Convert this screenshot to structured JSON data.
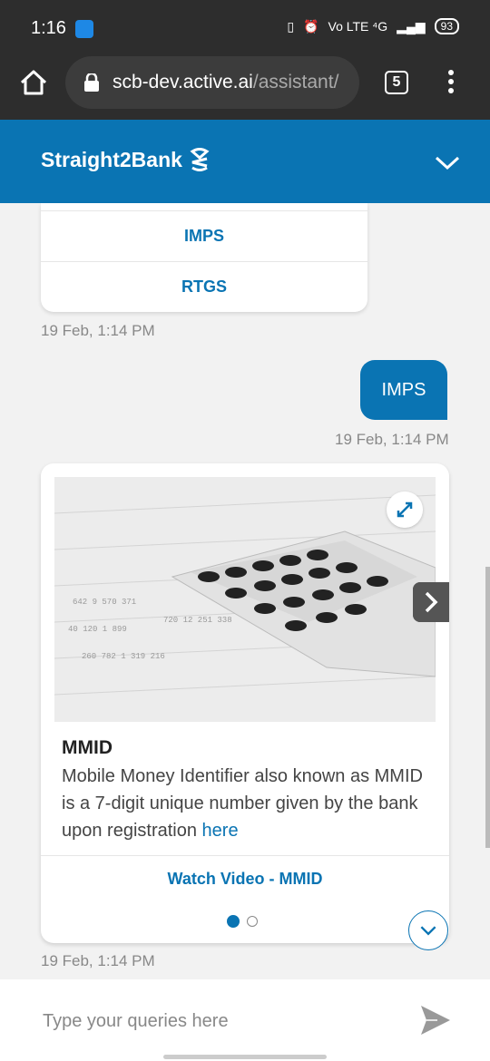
{
  "status_bar": {
    "time": "1:16",
    "network": "Vo LTE ⁴G",
    "battery": "93"
  },
  "browser": {
    "url_host": "scb-dev.active.ai",
    "url_path": "/assistant/",
    "tab_count": "5"
  },
  "header": {
    "brand": "Straight2Bank",
    "accent_color": "#0a74b3"
  },
  "chat": {
    "options": [
      {
        "label": "IMPS"
      },
      {
        "label": "RTGS"
      }
    ],
    "options_time": "19 Feb, 1:14 PM",
    "user_message": {
      "text": "IMPS",
      "time": "19 Feb, 1:14 PM"
    },
    "carousel": {
      "title": "MMID",
      "description": "Mobile Money Identifier also known as MMID is a 7-digit unique number given by the bank upon registration ",
      "link_text": "here",
      "action_label": "Watch Video - MMID",
      "time": "19 Feb, 1:14 PM",
      "page_count": 2,
      "active_page": 1
    }
  },
  "composer": {
    "placeholder": "Type your queries here"
  }
}
